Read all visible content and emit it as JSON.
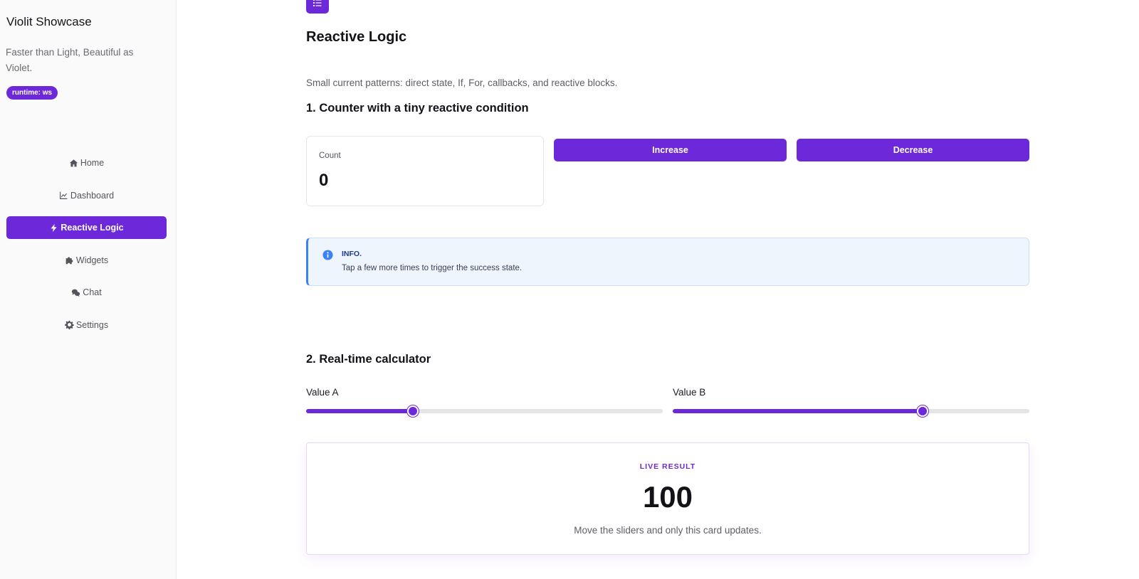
{
  "sidebar": {
    "title": "Violit Showcase",
    "tagline": "Faster than Light, Beautiful as Violet.",
    "runtime_badge": "runtime: ws",
    "items": [
      {
        "label": "Home",
        "icon": "home-icon",
        "active": false
      },
      {
        "label": "Dashboard",
        "icon": "chart-line-icon",
        "active": false
      },
      {
        "label": "Reactive Logic",
        "icon": "bolt-icon",
        "active": true
      },
      {
        "label": "Widgets",
        "icon": "puzzle-icon",
        "active": false
      },
      {
        "label": "Chat",
        "icon": "chat-bubbles-icon",
        "active": false
      },
      {
        "label": "Settings",
        "icon": "gear-icon",
        "active": false
      }
    ]
  },
  "page": {
    "title": "Reactive Logic",
    "icon": "list-icon",
    "description": "Small current patterns: direct state, If, For, callbacks, and reactive blocks."
  },
  "counter_section": {
    "title": "1. Counter with a tiny reactive condition",
    "count_label": "Count",
    "count_value": "0",
    "increase_label": "Increase",
    "decrease_label": "Decrease"
  },
  "info_alert": {
    "title": "INFO.",
    "text": "Tap a few more times to trigger the success state.",
    "icon": "info-circle-icon"
  },
  "calculator_section": {
    "title": "2. Real-time calculator",
    "slider_a": {
      "label": "Value A",
      "value_fraction": 0.3
    },
    "slider_b": {
      "label": "Value B",
      "value_fraction": 0.7
    },
    "result_label": "LIVE RESULT",
    "result_value": "100",
    "result_caption": "Move the sliders and only this card updates."
  },
  "colors": {
    "accent": "#6d28d9",
    "info": "#3b82f6",
    "info_bg": "#eef5fd"
  }
}
